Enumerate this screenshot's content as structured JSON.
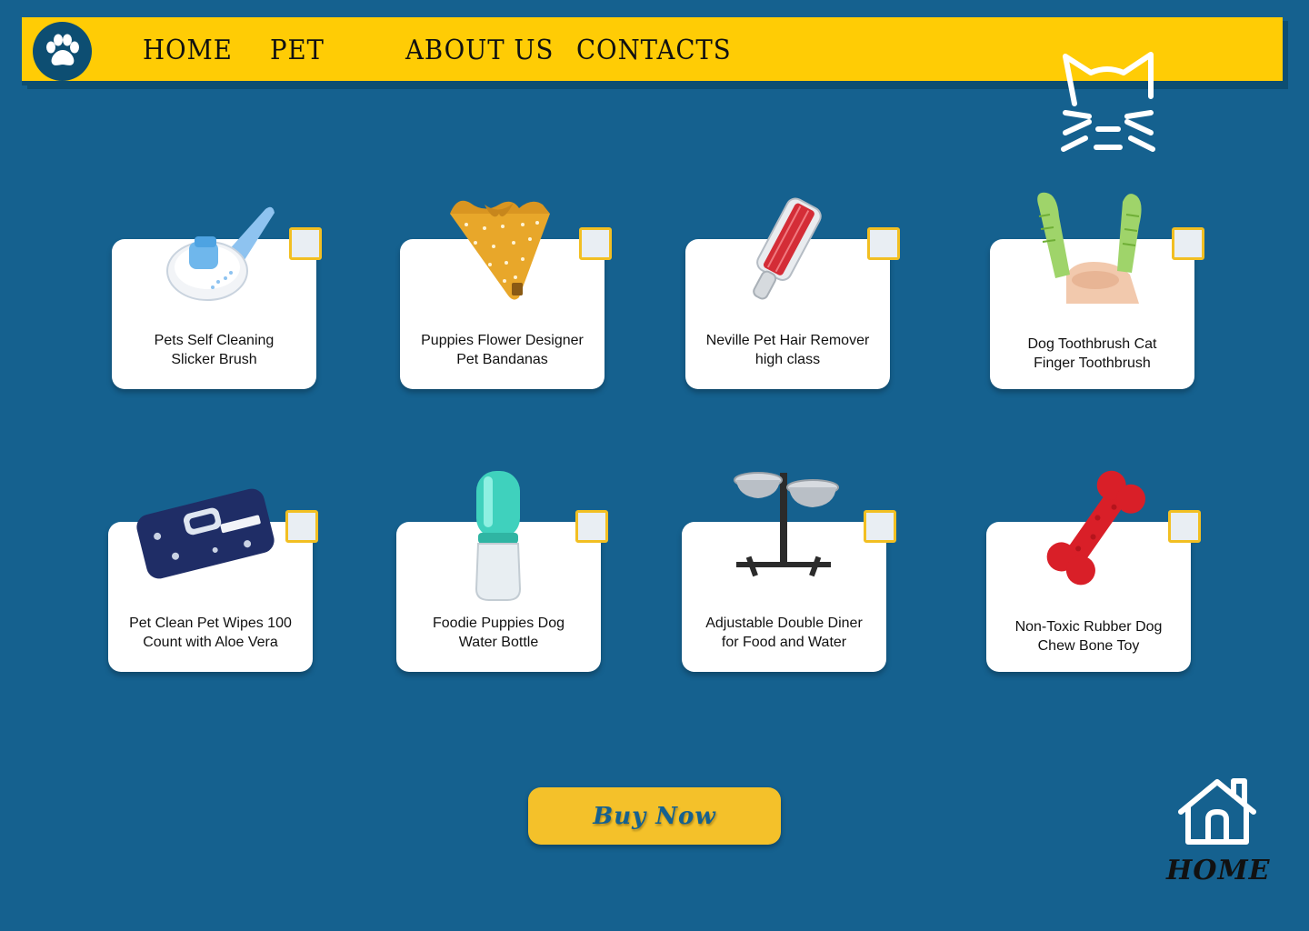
{
  "nav": {
    "links": [
      {
        "label": "HOME"
      },
      {
        "label": "PET"
      },
      {
        "label": "ABOUT US"
      },
      {
        "label": "CONTACTS"
      }
    ]
  },
  "products": [
    {
      "line1": "Pets Self Cleaning",
      "line2": "Slicker Brush",
      "icon": "slicker-brush"
    },
    {
      "line1": "Puppies Flower Designer",
      "line2": "Pet Bandanas",
      "icon": "bandana"
    },
    {
      "line1": "Neville Pet Hair Remover",
      "line2": "high class",
      "icon": "lint-roller"
    },
    {
      "line1": "Dog Toothbrush Cat",
      "line2": "Finger Toothbrush",
      "icon": "finger-toothbrush"
    },
    {
      "line1": "Pet Clean Pet Wipes 100",
      "line2": "Count with Aloe Vera",
      "icon": "wipes-pack"
    },
    {
      "line1": "Foodie Puppies Dog",
      "line2": "Water Bottle",
      "icon": "water-bottle"
    },
    {
      "line1": "Adjustable Double Diner",
      "line2": "for Food and Water",
      "icon": "double-bowl-stand"
    },
    {
      "line1": "Non-Toxic Rubber Dog",
      "line2": "Chew Bone Toy",
      "icon": "chew-bone"
    }
  ],
  "buy_button": {
    "label": "Buy Now"
  },
  "home": {
    "label": "HOME"
  },
  "colors": {
    "background": "#15618f",
    "navbar": "#ffcc05",
    "accent": "#f4c12a",
    "dark_blue": "#0d4e72"
  }
}
